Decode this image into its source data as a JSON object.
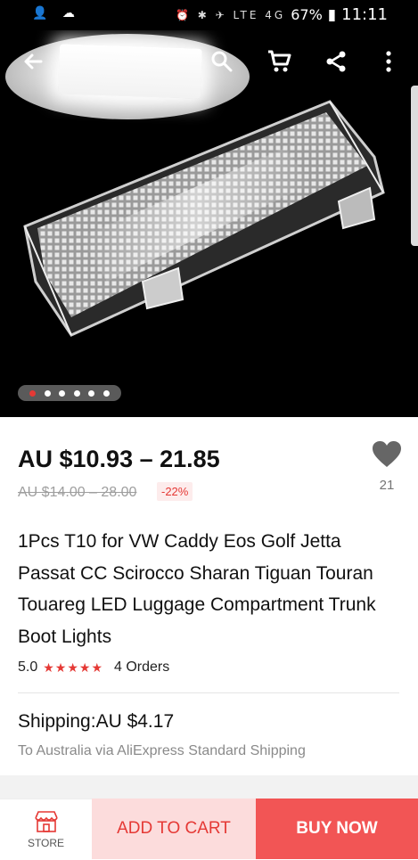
{
  "status_bar": {
    "left_icons": "👤 ☁",
    "right_icons": "⏰ ✱ ✈ LTE 4G",
    "battery": "67%",
    "time": "11:11"
  },
  "toolbar": {
    "back_icon": "back-arrow-icon",
    "search_icon": "search-icon",
    "cart_icon": "cart-icon",
    "share_icon": "share-icon",
    "more_icon": "more-vert-icon"
  },
  "gallery": {
    "image_count": 6,
    "active_index": 0
  },
  "product": {
    "price": "AU $10.93 – 21.85",
    "original_price": "AU $14.00 – 28.00",
    "discount": "-22%",
    "wishlist_count": "21",
    "title": "1Pcs T10 for VW Caddy Eos Golf Jetta Passat CC Scirocco Sharan Tiguan Touran Touareg LED Luggage Compartment Trunk Boot Lights",
    "rating": "5.0",
    "stars": "★★★★★",
    "orders": "4 Orders"
  },
  "shipping": {
    "title": "Shipping:AU $4.17",
    "subtitle": "To Australia via AliExpress Standard Shipping"
  },
  "bottom_bar": {
    "store_label": "STORE",
    "add_to_cart_label": "ADD TO CART",
    "buy_now_label": "BUY NOW"
  },
  "colors": {
    "accent": "#e53935",
    "buy_now_bg": "#f25555",
    "add_cart_bg": "#fcdcdc"
  }
}
